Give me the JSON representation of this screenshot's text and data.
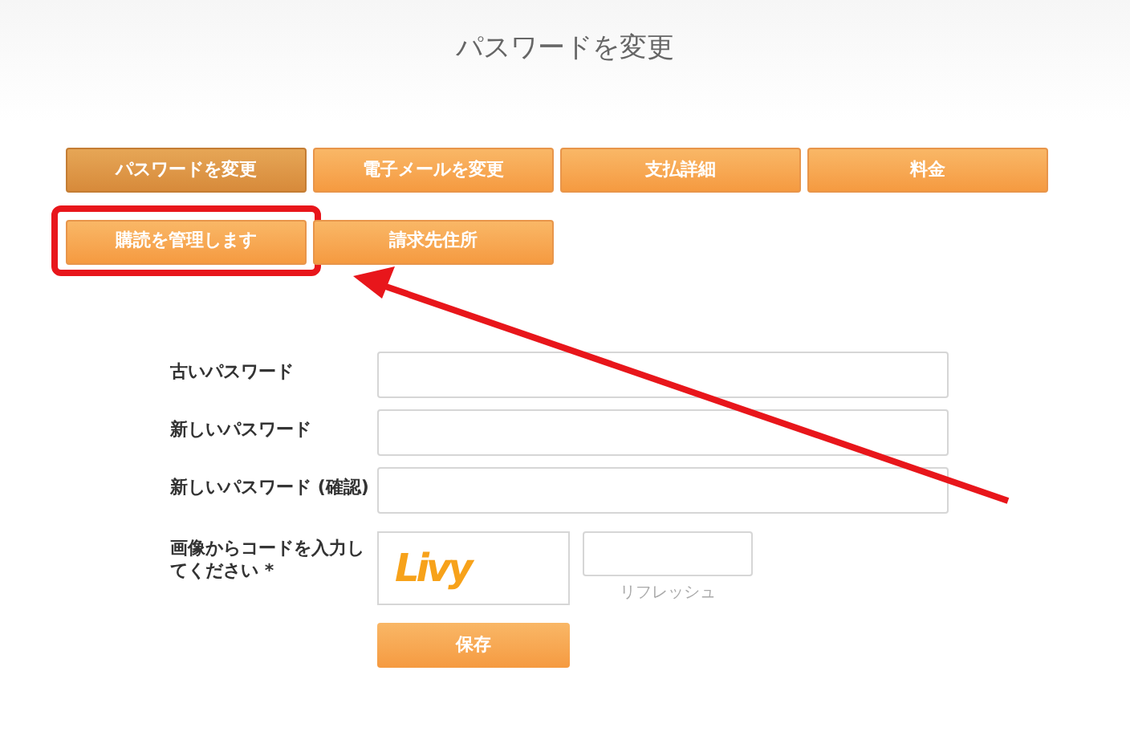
{
  "page": {
    "title": "パスワードを変更"
  },
  "tabs": [
    {
      "label": "パスワードを変更",
      "selected": true,
      "highlighted": false
    },
    {
      "label": "電子メールを変更",
      "selected": false,
      "highlighted": false
    },
    {
      "label": "支払詳細",
      "selected": false,
      "highlighted": false
    },
    {
      "label": "料金",
      "selected": false,
      "highlighted": false
    },
    {
      "label": "購読を管理します",
      "selected": false,
      "highlighted": true
    },
    {
      "label": "請求先住所",
      "selected": false,
      "highlighted": false
    }
  ],
  "form": {
    "fields": [
      {
        "label": "古いパスワード"
      },
      {
        "label": "新しいパスワード"
      },
      {
        "label": "新しいパスワード (確認)"
      }
    ],
    "captcha": {
      "label": "画像からコードを入力してください *",
      "code": "Livy",
      "refresh": "リフレッシュ"
    },
    "save_button": "保存"
  }
}
